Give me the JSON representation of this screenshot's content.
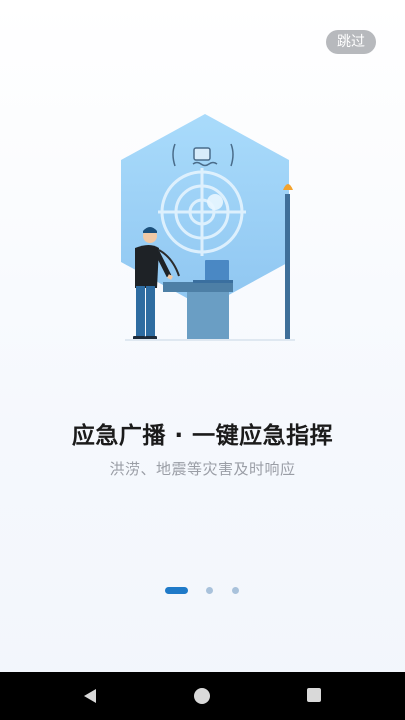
{
  "top": {
    "skip_label": "跳过"
  },
  "onboarding": {
    "title": "应急广播 · 一键应急指挥",
    "subtitle": "洪涝、地震等灾害及时响应",
    "page_indicator": {
      "total": 3,
      "current": 1
    }
  },
  "illustration": {
    "icon": "emergency-broadcast-illustration"
  },
  "system_nav": {
    "back_icon": "back-triangle-icon",
    "home_icon": "home-circle-icon",
    "recent_icon": "recent-square-icon"
  },
  "colors": {
    "accent": "#1f7ac8",
    "hexagon": "#9fd0f5",
    "pole": "#3f6f99"
  }
}
